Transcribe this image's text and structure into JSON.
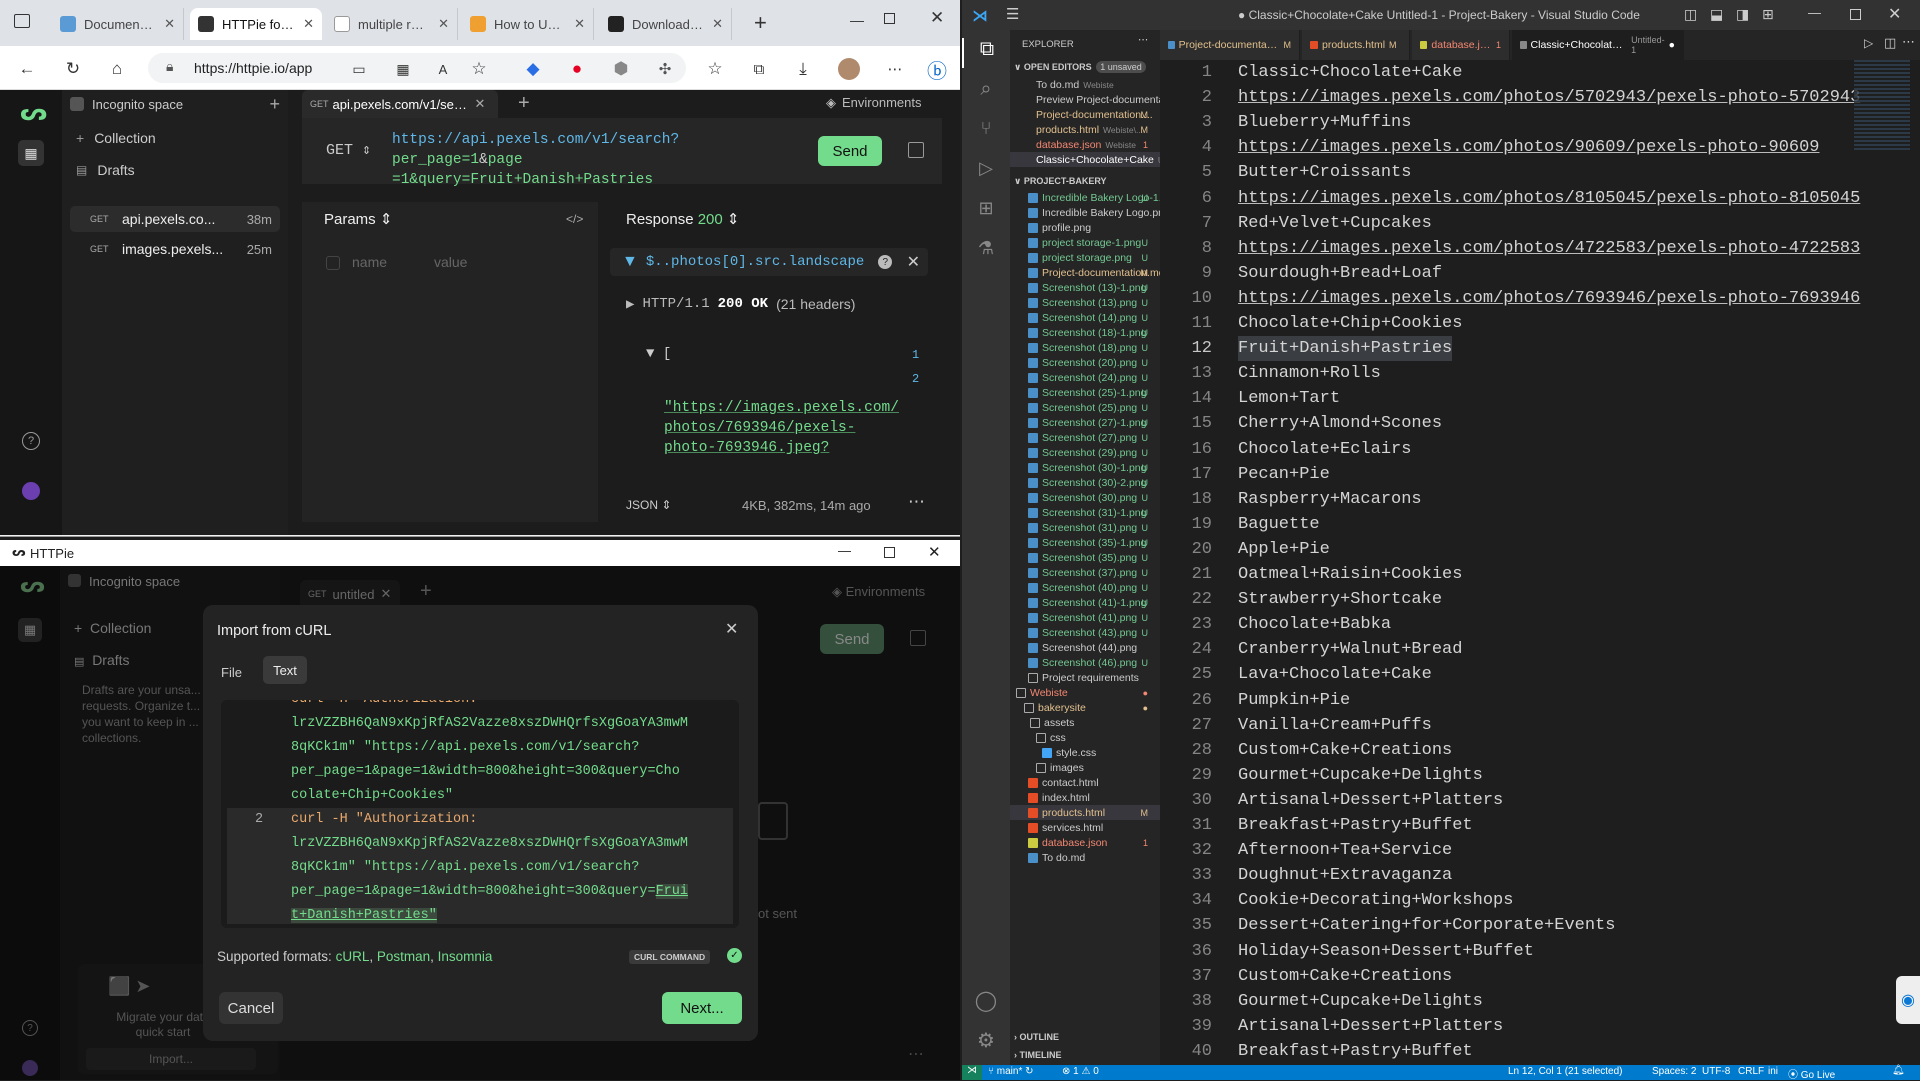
{
  "browser": {
    "tabs": [
      {
        "label": "Documentatic",
        "icon": "doc-icon"
      },
      {
        "label": "HTTPie for We",
        "icon": "httpie-icon"
      },
      {
        "label": "multiple requ",
        "icon": "search-icon"
      },
      {
        "label": "How to Use H",
        "icon": "globe-icon"
      },
      {
        "label": "Download HT",
        "icon": "httpie-icon"
      }
    ],
    "url": "https://httpie.io/app"
  },
  "web": {
    "space": "Incognito space",
    "collection": "Collection",
    "drafts": "Drafts",
    "drafts_items": [
      {
        "method": "GET",
        "name": "api.pexels.co...",
        "age": "38m"
      },
      {
        "method": "GET",
        "name": "images.pexels...",
        "age": "25m"
      }
    ],
    "tab": {
      "method": "GET",
      "label": "api.pexels.com/v1/sea..."
    },
    "environments": "Environments",
    "method": "GET",
    "url_parts": {
      "base": "https://api.pexels.com/v1/search?",
      "q1": "per_page=1",
      "amp1": "&",
      "q2": "page",
      "line2": "=1&query=Fruit+Danish+Pastries"
    },
    "send": "Send",
    "params_label": "Params",
    "param_name_ph": "name",
    "param_value_ph": "value",
    "response_label": "Response",
    "response_code": "200",
    "filter": "$..photos[0].src.landscape",
    "http_status": "HTTP/1.1",
    "http_code": "200 OK",
    "http_headers": "(21 headers)",
    "bracket": "[",
    "line_nums": [
      "1",
      "2"
    ],
    "result_lines": [
      "\"https://images.pexels.com/",
      "photos/7693946/pexels-",
      "photo-7693946.jpeg?"
    ],
    "format": "JSON",
    "meta": "4KB, 382ms, 14m ago"
  },
  "desktop": {
    "title": "HTTPie",
    "space": "Incognito space",
    "collection": "Collection",
    "drafts": "Drafts",
    "drafts_help": "Drafts are your unsa... requests. Organize t... you want to keep in ... collections.",
    "tab": {
      "method": "GET",
      "label": "untitled"
    },
    "environments": "Environments",
    "send": "Send",
    "not_sent": "ot sent",
    "migrate": "Migrate your data quick start",
    "import": "Import..."
  },
  "modal": {
    "title": "Import from cURL",
    "tabs": [
      "File",
      "Text"
    ],
    "lines_1": [
      "curl -H \"Authorization:",
      "lrzVZZBH6QaN9xKpjRfAS2Vazze8xszDWHQrfsXgGoaYA3mwM",
      "8qKCk1m\" \"https://api.pexels.com/v1/search?",
      "per_page=1&page=1&width=800&height=300&query=Cho",
      "colate+Chip+Cookies\""
    ],
    "line2_num": "2",
    "lines_2": [
      "curl -H \"Authorization:",
      "lrzVZZBH6QaN9xKpjRfAS2Vazze8xszDWHQrfsXgGoaYA3mwM",
      "8qKCk1m\" \"https://api.pexels.com/v1/search?",
      "per_page=1&page=1&width=800&height=300&query=",
      "Frui",
      "t+Danish+Pastries\""
    ],
    "supported_label": "Supported formats:",
    "supported": [
      "cURL",
      "Postman",
      "Insomnia"
    ],
    "curl_badge": "CURL COMMAND",
    "cancel": "Cancel",
    "next": "Next..."
  },
  "vscode": {
    "title": "● Classic+Chocolate+Cake Untitled-1 - Project-Bakery - Visual Studio Code",
    "explorer": "EXPLORER",
    "open_editors": "OPEN EDITORS",
    "unsaved": "1 unsaved",
    "open_files": [
      {
        "name": "To do.md",
        "hint": "Webiste",
        "badge": "",
        "color": "#cccccc"
      },
      {
        "name": "Preview Project-documentat...",
        "hint": "",
        "badge": "",
        "color": "#cccccc"
      },
      {
        "name": "Project-documentation....",
        "hint": "",
        "badge": "M",
        "color": "#e2c08d"
      },
      {
        "name": "products.html",
        "hint": "Webiste\\...",
        "badge": "M",
        "color": "#e2c08d"
      },
      {
        "name": "database.json",
        "hint": "Webiste",
        "badge": "1",
        "color": "#f48771"
      },
      {
        "name": "Classic+Chocolate+Cake",
        "hint": "Un...",
        "badge": "",
        "color": "#ffffff"
      }
    ],
    "project": "PROJECT-BAKERY",
    "files": [
      {
        "name": "Incredible Bakery Logo-1....",
        "badge": "U",
        "color": "#73c991"
      },
      {
        "name": "Incredible Bakery Logo.png",
        "badge": "",
        "color": "#cccccc"
      },
      {
        "name": "profile.png",
        "badge": "",
        "color": "#cccccc"
      },
      {
        "name": "project storage-1.png",
        "badge": "U",
        "color": "#73c991"
      },
      {
        "name": "project storage.png",
        "badge": "U",
        "color": "#73c991"
      },
      {
        "name": "Project-documentation.md",
        "badge": "M",
        "color": "#e2c08d"
      },
      {
        "name": "Screenshot (13)-1.png",
        "badge": "U",
        "color": "#73c991"
      },
      {
        "name": "Screenshot (13).png",
        "badge": "U",
        "color": "#73c991"
      },
      {
        "name": "Screenshot (14).png",
        "badge": "U",
        "color": "#73c991"
      },
      {
        "name": "Screenshot (18)-1.png",
        "badge": "U",
        "color": "#73c991"
      },
      {
        "name": "Screenshot (18).png",
        "badge": "U",
        "color": "#73c991"
      },
      {
        "name": "Screenshot (20).png",
        "badge": "U",
        "color": "#73c991"
      },
      {
        "name": "Screenshot (24).png",
        "badge": "U",
        "color": "#73c991"
      },
      {
        "name": "Screenshot (25)-1.png",
        "badge": "U",
        "color": "#73c991"
      },
      {
        "name": "Screenshot (25).png",
        "badge": "U",
        "color": "#73c991"
      },
      {
        "name": "Screenshot (27)-1.png",
        "badge": "U",
        "color": "#73c991"
      },
      {
        "name": "Screenshot (27).png",
        "badge": "U",
        "color": "#73c991"
      },
      {
        "name": "Screenshot (29).png",
        "badge": "U",
        "color": "#73c991"
      },
      {
        "name": "Screenshot (30)-1.png",
        "badge": "U",
        "color": "#73c991"
      },
      {
        "name": "Screenshot (30)-2.png",
        "badge": "U",
        "color": "#73c991"
      },
      {
        "name": "Screenshot (30).png",
        "badge": "U",
        "color": "#73c991"
      },
      {
        "name": "Screenshot (31)-1.png",
        "badge": "U",
        "color": "#73c991"
      },
      {
        "name": "Screenshot (31).png",
        "badge": "U",
        "color": "#73c991"
      },
      {
        "name": "Screenshot (35)-1.png",
        "badge": "U",
        "color": "#73c991"
      },
      {
        "name": "Screenshot (35).png",
        "badge": "U",
        "color": "#73c991"
      },
      {
        "name": "Screenshot (37).png",
        "badge": "U",
        "color": "#73c991"
      },
      {
        "name": "Screenshot (40).png",
        "badge": "U",
        "color": "#73c991"
      },
      {
        "name": "Screenshot (41)-1.png",
        "badge": "U",
        "color": "#73c991"
      },
      {
        "name": "Screenshot (41).png",
        "badge": "U",
        "color": "#73c991"
      },
      {
        "name": "Screenshot (43).png",
        "badge": "U",
        "color": "#73c991"
      },
      {
        "name": "Screenshot (44).png",
        "badge": "",
        "color": "#cccccc"
      },
      {
        "name": "Screenshot (46).png",
        "badge": "U",
        "color": "#73c991"
      },
      {
        "name": "Project requirements",
        "badge": "",
        "color": "#cccccc"
      },
      {
        "name": "Webiste",
        "badge": "●",
        "color": "#f48771"
      },
      {
        "name": "bakerysite",
        "badge": "●",
        "color": "#e2c08d"
      },
      {
        "name": "assets",
        "badge": "",
        "color": "#cccccc"
      },
      {
        "name": "css",
        "badge": "",
        "color": "#cccccc"
      },
      {
        "name": "style.css",
        "badge": "",
        "color": "#cccccc"
      },
      {
        "name": "images",
        "badge": "",
        "color": "#cccccc"
      },
      {
        "name": "contact.html",
        "badge": "",
        "color": "#cccccc"
      },
      {
        "name": "index.html",
        "badge": "",
        "color": "#cccccc"
      },
      {
        "name": "products.html",
        "badge": "M",
        "color": "#e2c08d"
      },
      {
        "name": "services.html",
        "badge": "",
        "color": "#cccccc"
      },
      {
        "name": "database.json",
        "badge": "1",
        "color": "#f48771"
      },
      {
        "name": "To do.md",
        "badge": "",
        "color": "#cccccc"
      }
    ],
    "outline": "OUTLINE",
    "timeline": "TIMELINE",
    "tabs": [
      {
        "label": "Project-documentation.md",
        "badge": "M",
        "color": "#e2c08d"
      },
      {
        "label": "products.html",
        "badge": "M",
        "color": "#e2c08d"
      },
      {
        "label": "database.json",
        "badge": "1",
        "color": "#f48771"
      },
      {
        "label": "Classic+Chocolate+Cake",
        "badge": "Untitled-1",
        "color": "#ffffff"
      }
    ],
    "lines": [
      "Classic+Chocolate+Cake",
      "https://images.pexels.com/photos/5702943/pexels-photo-5702943",
      "Blueberry+Muffins",
      "https://images.pexels.com/photos/90609/pexels-photo-90609",
      "Butter+Croissants",
      "https://images.pexels.com/photos/8105045/pexels-photo-8105045",
      "Red+Velvet+Cupcakes",
      "https://images.pexels.com/photos/4722583/pexels-photo-4722583",
      "Sourdough+Bread+Loaf",
      "https://images.pexels.com/photos/7693946/pexels-photo-7693946",
      "Chocolate+Chip+Cookies",
      "Fruit+Danish+Pastries",
      "Cinnamon+Rolls",
      "Lemon+Tart",
      "Cherry+Almond+Scones",
      "Chocolate+Eclairs",
      "Pecan+Pie",
      "Raspberry+Macarons",
      "Baguette",
      "Apple+Pie",
      "Oatmeal+Raisin+Cookies",
      "Strawberry+Shortcake",
      "Chocolate+Babka",
      "Cranberry+Walnut+Bread",
      "Lava+Chocolate+Cake",
      "Pumpkin+Pie",
      "Vanilla+Cream+Puffs",
      "Custom+Cake+Creations",
      "Gourmet+Cupcake+Delights",
      "Artisanal+Dessert+Platters",
      "Breakfast+Pastry+Buffet",
      "Afternoon+Tea+Service",
      "Doughnut+Extravaganza",
      "Cookie+Decorating+Workshops",
      "Dessert+Catering+for+Corporate+Events",
      "Holiday+Season+Dessert+Buffet",
      "Custom+Cake+Creations",
      "Gourmet+Cupcake+Delights",
      "Artisanal+Dessert+Platters",
      "Breakfast+Pastry+Buffet"
    ],
    "current_line": 12,
    "status_left": [
      "main*",
      "⊗ 1 ⚠ 0"
    ],
    "status_right": [
      "Ln 12, Col 1 (21 selected)",
      "Spaces: 2",
      "UTF-8",
      "CRLF",
      "ini",
      "Go Live"
    ]
  }
}
